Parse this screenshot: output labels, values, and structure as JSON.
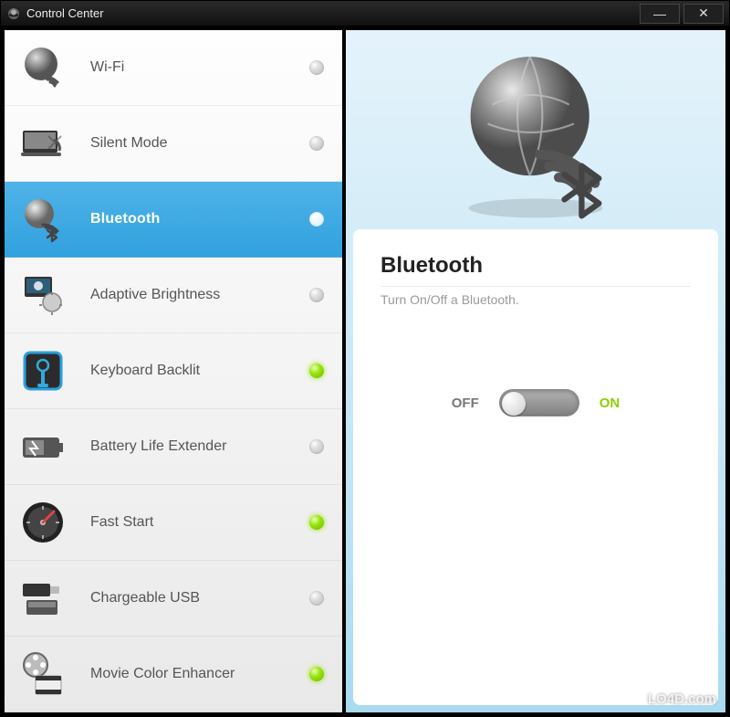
{
  "window": {
    "title": "Control Center"
  },
  "sidebar": {
    "items": [
      {
        "label": "Wi-Fi",
        "icon": "wifi-globe-icon",
        "selected": false,
        "state": "off"
      },
      {
        "label": "Silent Mode",
        "icon": "silent-mode-icon",
        "selected": false,
        "state": "off"
      },
      {
        "label": "Bluetooth",
        "icon": "bluetooth-globe-icon",
        "selected": true,
        "state": "off"
      },
      {
        "label": "Adaptive Brightness",
        "icon": "brightness-icon",
        "selected": false,
        "state": "off"
      },
      {
        "label": "Keyboard Backlit",
        "icon": "keyboard-backlit-icon",
        "selected": false,
        "state": "on"
      },
      {
        "label": "Battery Life Extender",
        "icon": "battery-icon",
        "selected": false,
        "state": "off"
      },
      {
        "label": "Fast Start",
        "icon": "fast-start-icon",
        "selected": false,
        "state": "on"
      },
      {
        "label": "Chargeable USB",
        "icon": "usb-icon",
        "selected": false,
        "state": "off"
      },
      {
        "label": "Movie Color Enhancer",
        "icon": "movie-icon",
        "selected": false,
        "state": "on"
      }
    ]
  },
  "main": {
    "hero_icon": "bluetooth-globe-icon",
    "title": "Bluetooth",
    "description": "Turn On/Off a Bluetooth.",
    "toggle": {
      "off_label": "OFF",
      "on_label": "ON",
      "value": "off"
    }
  },
  "watermark": "LO4D.com",
  "colors": {
    "selected_bg": "#3aa7e0",
    "accent_green": "#8dcf00"
  }
}
